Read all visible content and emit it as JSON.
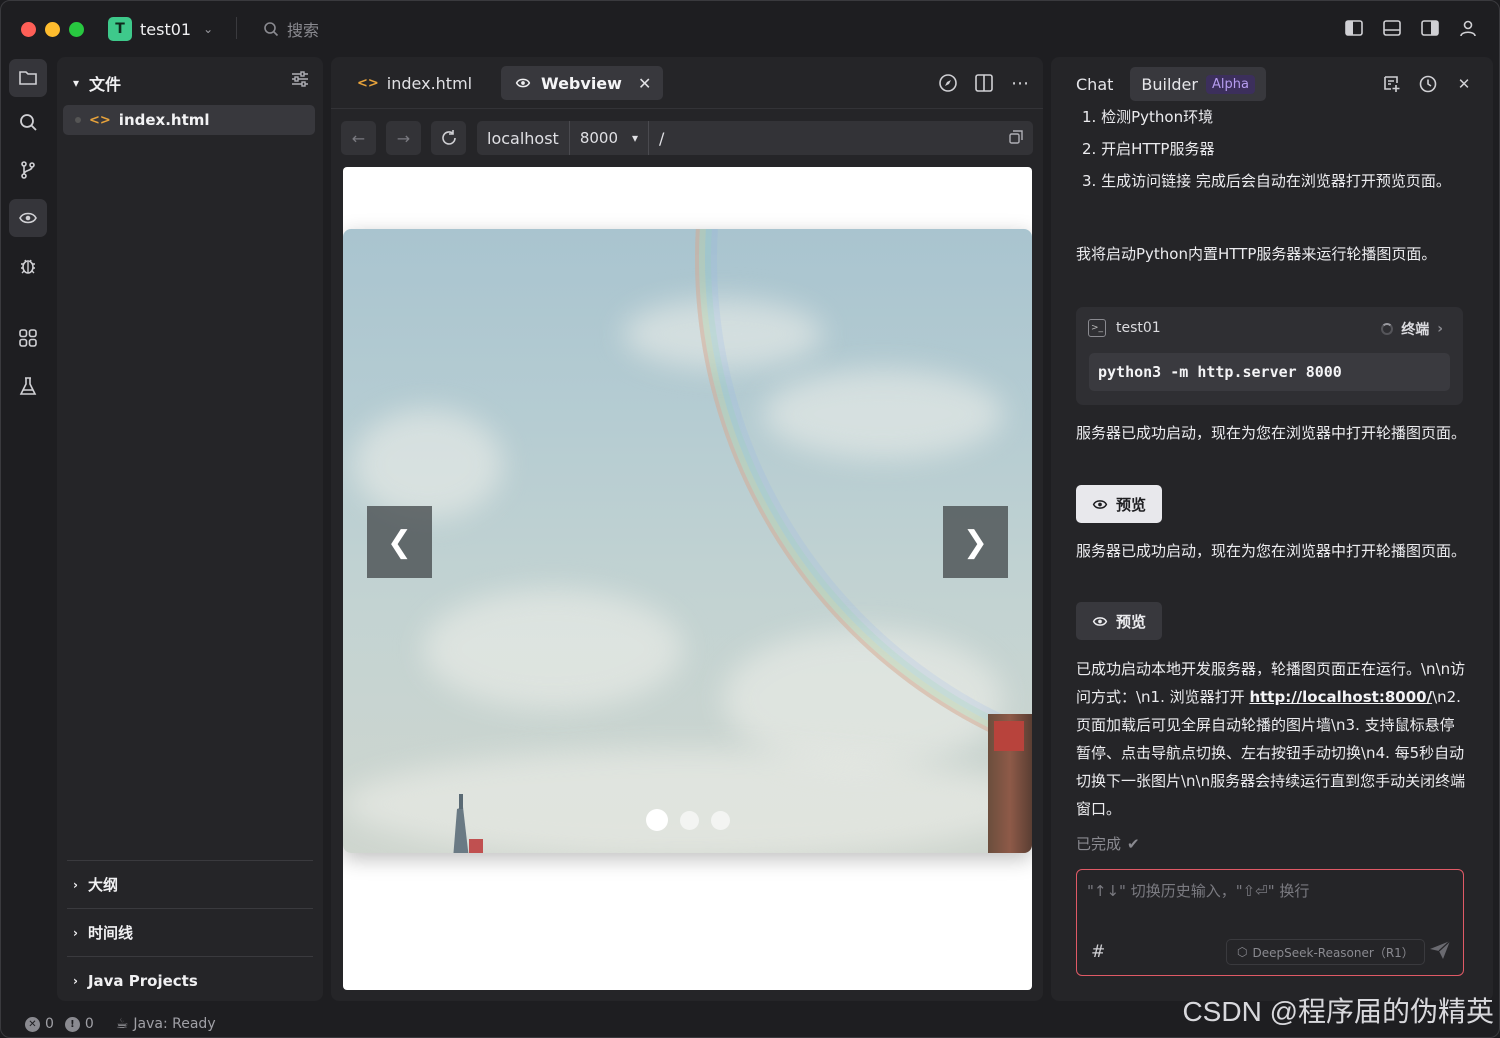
{
  "titlebar": {
    "project_initial": "T",
    "project_name": "test01",
    "search_placeholder": "搜索"
  },
  "explorer": {
    "header": "文件",
    "file": "index.html",
    "sections": [
      "大纲",
      "时间线",
      "Java Projects"
    ]
  },
  "editor": {
    "tabs": [
      {
        "label": "index.html",
        "active": false
      },
      {
        "label": "Webview",
        "active": true
      }
    ],
    "url": {
      "host": "localhost",
      "port": "8000",
      "path": "/"
    }
  },
  "carousel": {
    "prev_label": "❮",
    "next_label": "❯",
    "dot_count": 3,
    "active_dot": 0
  },
  "chat": {
    "tabs": {
      "chat": "Chat",
      "builder": "Builder",
      "badge": "Alpha"
    },
    "steps": [
      "1. 检测Python环境",
      "2. 开启HTTP服务器",
      "3. 生成访问链接 完成后会自动在浏览器打开预览页面。"
    ],
    "intro": "我将启动Python内置HTTP服务器来运行轮播图页面。",
    "terminal": {
      "name": "test01",
      "label": "终端",
      "command": "python3 -m http.server 8000"
    },
    "server_msg_1": "服务器已成功启动，现在为您在浏览器中打开轮播图页面。",
    "preview_label_1": "预览",
    "server_msg_2": "服务器已成功启动，现在为您在浏览器中打开轮播图页面。",
    "preview_label_2": "预览",
    "summary_a": "已成功启动本地开发服务器，轮播图页面正在运行。\\n\\n访问方式：\\n1. 浏览器打开",
    "summary_link": "http://localhost:8000/",
    "summary_b": "\\n2. 页面加载后可见全屏自动轮播的图片墙\\n3. 支持鼠标悬停暂停、点击导航点切换、左右按钮手动切换\\n4. 每5秒自动切换下一张图片\\n\\n服务器会持续运行直到您手动关闭终端窗口。",
    "done_label": "已完成",
    "input_placeholder": "\"↑↓\" 切换历史输入，\"⇧⏎\" 换行",
    "hash_label": "#",
    "model_label": "DeepSeek-Reasoner（R1）"
  },
  "status": {
    "errors": "0",
    "warnings": "0",
    "java": "Java: Ready"
  },
  "watermark": "CSDN @程序届的伪精英"
}
